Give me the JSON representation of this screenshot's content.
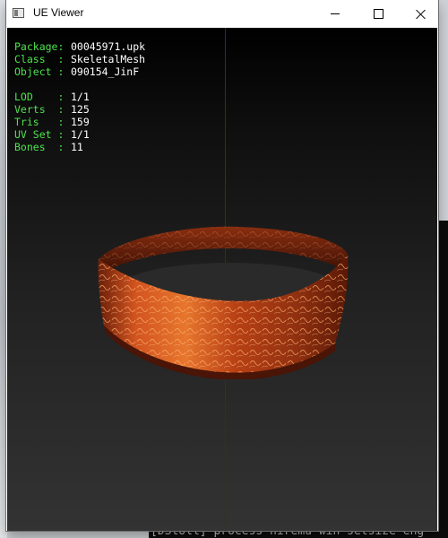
{
  "window": {
    "title": "UE Viewer"
  },
  "info": {
    "package": {
      "label": "Package:",
      "value": "00045971.upk"
    },
    "class": {
      "label": "Class  :",
      "value": "SkeletalMesh"
    },
    "object": {
      "label": "Object :",
      "value": "090154_JinF"
    },
    "lod": {
      "label": "LOD    :",
      "value": "1/1"
    },
    "verts": {
      "label": "Verts  :",
      "value": "125"
    },
    "tris": {
      "label": "Tris   :",
      "value": "159"
    },
    "uvset": {
      "label": "UV Set :",
      "value": "1/1"
    },
    "bones": {
      "label": "Bones  :",
      "value": "11"
    }
  },
  "console": {
    "bottom_text": "[DStoll] process  hiremu win setsize  eng"
  },
  "colors": {
    "label": "#4ee24e",
    "value": "#ffffff",
    "axis": "#1a1ad8",
    "mesh": "#c2461c"
  },
  "icons": {
    "app": "window-app-icon",
    "minimize": "minimize-icon",
    "maximize": "maximize-icon",
    "close": "close-icon"
  }
}
